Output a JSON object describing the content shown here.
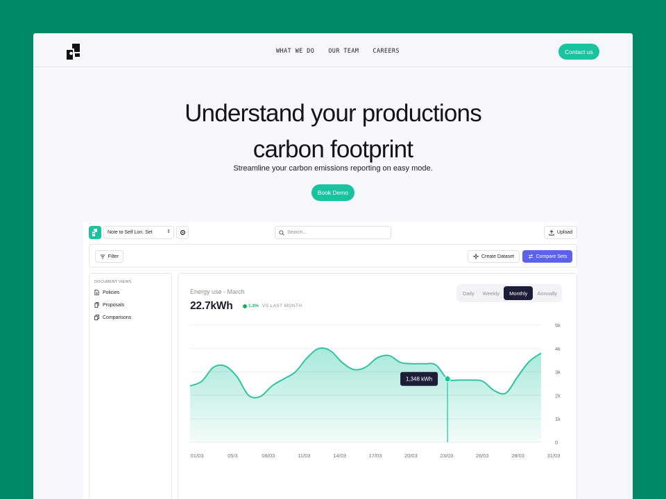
{
  "nav": {
    "links": [
      "WHAT WE DO",
      "OUR TEAM",
      "CAREERS"
    ],
    "contact_label": "Contact us"
  },
  "hero": {
    "title_line1": "Understand your productions",
    "title_line2": "carbon footprint",
    "subtitle": "Streamline your carbon emissions reporting on easy mode.",
    "cta_label": "Book Demo"
  },
  "app": {
    "dataset_select": "Note to Self Lon. Set",
    "search_placeholder": "Search...",
    "upload_label": "Upload",
    "filter_label": "Filter",
    "create_label": "Create Dataset",
    "compare_label": "Compare Sets"
  },
  "sidebar": {
    "heading": "DOCUMENT VIEWS",
    "items": [
      {
        "label": "Policies",
        "icon": "document-icon"
      },
      {
        "label": "Proposals",
        "icon": "documents-icon"
      },
      {
        "label": "Comparisons",
        "icon": "copy-icon"
      }
    ]
  },
  "metric": {
    "label": "Energy use - March",
    "value": "22.7kWh",
    "delta": "1.3%",
    "delta_note": "VS LAST MONTH",
    "delta_color": "#17b35f"
  },
  "periods": {
    "options": [
      "Daily",
      "Weekly",
      "Monthly",
      "Annually"
    ],
    "selected": "Monthly"
  },
  "colors": {
    "brand": "#19c39f",
    "accent_button": "#5d62ee",
    "dark": "#1c1d36",
    "background": "#018866"
  },
  "chart_data": {
    "type": "area",
    "x": [
      "01/03",
      "02/03",
      "03/03",
      "04/03",
      "05/03",
      "06/03",
      "07/03",
      "08/03",
      "09/03",
      "10/03",
      "11/03",
      "12/03",
      "13/03",
      "14/03",
      "15/03",
      "16/03",
      "17/03",
      "18/03",
      "19/03",
      "20/03",
      "21/03",
      "22/03",
      "23/03",
      "24/03",
      "25/03",
      "26/03",
      "27/03",
      "28/03",
      "29/03",
      "30/03",
      "31/03"
    ],
    "x_tick_labels": [
      "01/03",
      "05/3",
      "08/03",
      "11/03",
      "14/03",
      "17/03",
      "20/03",
      "23/03",
      "26/03",
      "28/03",
      "31/03"
    ],
    "series": [
      {
        "values": [
          2400,
          2600,
          3200,
          3250,
          2800,
          2000,
          1950,
          2400,
          2700,
          3000,
          3600,
          4000,
          3900,
          3400,
          3100,
          3200,
          3600,
          3700,
          3400,
          3350,
          3348,
          3300,
          2700,
          2650,
          2650,
          2600,
          2200,
          2100,
          2800,
          3450,
          3800
        ]
      }
    ],
    "y_ticks": [
      "0",
      "1k",
      "2k",
      "3k",
      "4k",
      "5k"
    ],
    "ylim": [
      0,
      5000
    ],
    "grid": true,
    "highlight": {
      "x": "23/03",
      "label": "1,348 kWh"
    }
  }
}
